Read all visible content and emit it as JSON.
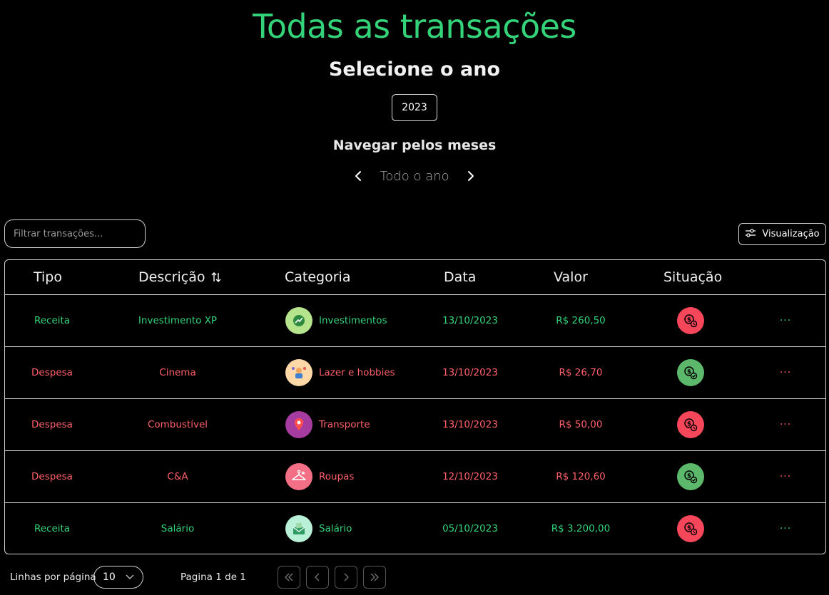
{
  "header": {
    "title": "Todas as transações",
    "subtitle": "Selecione o ano",
    "year": "2023",
    "nav_label": "Navegar pelos meses",
    "month": "Todo o ano"
  },
  "toolbar": {
    "filter_placeholder": "Filtrar transações...",
    "view_label": "Visualização"
  },
  "table": {
    "columns": [
      "Tipo",
      "Descrição",
      "Categoria",
      "Data",
      "Valor",
      "Situação"
    ],
    "rows": [
      {
        "tipo": "Receita",
        "descricao": "Investimento XP",
        "categoria": "Investimentos",
        "data": "13/10/2023",
        "valor": "R$ 260,50",
        "situacao": "pending",
        "tone": "green",
        "icon": "investment-icon",
        "icon_bg": "#b5e48c",
        "actions": "···"
      },
      {
        "tipo": "Despesa",
        "descricao": "Cinema",
        "categoria": "Lazer e hobbies",
        "data": "13/10/2023",
        "valor": "R$ 26,70",
        "situacao": "paid",
        "tone": "red",
        "icon": "leisure-icon",
        "icon_bg": "#ffd8a8",
        "actions": "···"
      },
      {
        "tipo": "Despesa",
        "descricao": "Combustível",
        "categoria": "Transporte",
        "data": "13/10/2023",
        "valor": "R$ 50,00",
        "situacao": "pending",
        "tone": "red",
        "icon": "transport-icon",
        "icon_bg": "#a63ca0",
        "actions": "···"
      },
      {
        "tipo": "Despesa",
        "descricao": "C&A",
        "categoria": "Roupas",
        "data": "12/10/2023",
        "valor": "R$ 120,60",
        "situacao": "paid",
        "tone": "red",
        "icon": "clothes-hanger-icon",
        "icon_bg": "#f36f85",
        "actions": "···"
      },
      {
        "tipo": "Receita",
        "descricao": "Salário",
        "categoria": "Salário",
        "data": "05/10/2023",
        "valor": "R$ 3.200,00",
        "situacao": "pending",
        "tone": "green",
        "icon": "salary-envelope-icon",
        "icon_bg": "#b8f0d8",
        "actions": "···"
      }
    ]
  },
  "footer": {
    "rows_label": "Linhas por página",
    "rows_value": "10",
    "page_info": "Pagina 1 de 1"
  },
  "colors": {
    "green": "#34d37a",
    "red": "#ff5f6a",
    "status_pending": "#f6465a",
    "status_paid": "#5cb86a"
  }
}
